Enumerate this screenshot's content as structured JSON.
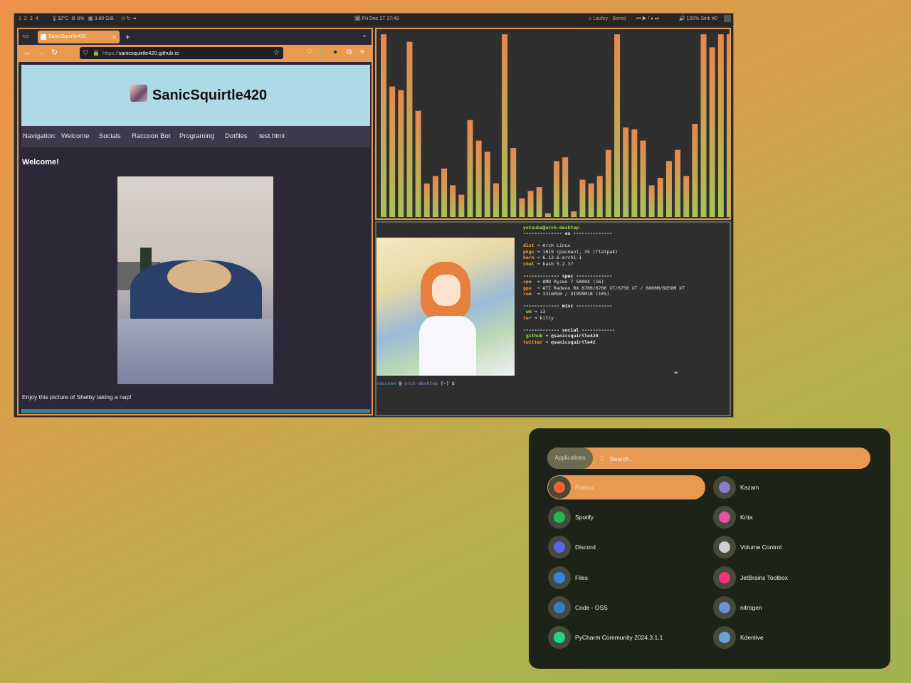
{
  "topbar": {
    "workspaces": [
      "1",
      "2",
      "3",
      "4"
    ],
    "active_workspace": "1",
    "temp": "32°C",
    "cpu": "8%",
    "mem": "3.80 GiB",
    "datetime": "Fri Dec 27 17:49",
    "now_playing": "Laufey - Bored",
    "media_controls": "⏮ ▶ / ⏸ ⏭",
    "volume": "100% Sink #0"
  },
  "browser": {
    "tab_title": "SanicSquirtle420",
    "url_prefix": "https://",
    "url_host": "sanicsquirtle420.github.io",
    "site_title": "SanicSquirtle420",
    "nav_label": "Navigation:",
    "nav_links": [
      "Welcome",
      "Socials",
      "Raccoon Bot",
      "Programing",
      "Dotfiles",
      "test.html"
    ],
    "heading": "Welcome!",
    "caption": "Enjoy this picture of Shelby taking a nap!"
  },
  "visualizer": {
    "bars": [
      0.98,
      0.7,
      0.68,
      0.94,
      0.57,
      0.18,
      0.22,
      0.26,
      0.17,
      0.12,
      0.52,
      0.41,
      0.35,
      0.18,
      0.98,
      0.37,
      0.1,
      0.14,
      0.16,
      0.02,
      0.3,
      0.32,
      0.03,
      0.2,
      0.18,
      0.22,
      0.36,
      0.98,
      0.48,
      0.47,
      0.41,
      0.17,
      0.21,
      0.3,
      0.36,
      0.22,
      0.5,
      0.98,
      0.91,
      0.98,
      0.98
    ],
    "color_top": "#e8874f",
    "color_bottom": "#a8c25a"
  },
  "terminal": {
    "user": "yotsuba",
    "host": "arch-desktop",
    "sections": {
      "os": "os",
      "spec": "spec",
      "misc": "misc",
      "social": "social"
    },
    "rows": [
      {
        "key": "dist",
        "value": "Arch Linux"
      },
      {
        "key": "pkgs",
        "value": "1019 (pacman), 35 (flatpak)"
      },
      {
        "key": "kern",
        "value": "6.12.6-arch1-1"
      },
      {
        "key": "shel",
        "value": "bash 5.2.37"
      },
      {
        "key": "cpu",
        "value": "AMD Ryzen 7 5800X (16)"
      },
      {
        "key": "gpu",
        "value": "ATI Radeon RX 6700/6700 XT/6750 XT / 6800M/6850M XT"
      },
      {
        "key": "ram",
        "value": "3316MiB / 31995MiB (10%)"
      },
      {
        "key": "wm",
        "value": "i3"
      },
      {
        "key": "ter",
        "value": "kitty"
      },
      {
        "key": "github",
        "value": "@sanicsquirtle420"
      },
      {
        "key": "twitter",
        "value": "@sanicsquirtle42"
      }
    ],
    "prompt_user": "raccoon",
    "prompt_at": "@",
    "prompt_host": "arch-desktop",
    "prompt_path": "[~]",
    "prompt_symbol": "$"
  },
  "launcher": {
    "mode": "Applications",
    "separator": "::",
    "search_placeholder": "Search...",
    "apps_left": [
      {
        "name": "Firefox",
        "icon": "firefox-icon",
        "color": "#f2622e",
        "selected": true
      },
      {
        "name": "Spotify",
        "icon": "spotify-icon",
        "color": "#1db954"
      },
      {
        "name": "Discord",
        "icon": "discord-icon",
        "color": "#5865f2"
      },
      {
        "name": "Files",
        "icon": "files-icon",
        "color": "#3d7fe0"
      },
      {
        "name": "Code - OSS",
        "icon": "code-oss-icon",
        "color": "#2f80c9"
      },
      {
        "name": "PyCharm Community 2024.3.1.1",
        "icon": "pycharm-icon",
        "color": "#21d789"
      }
    ],
    "apps_right": [
      {
        "name": "Kazam",
        "icon": "kazam-icon",
        "color": "#8a7cc8"
      },
      {
        "name": "Krita",
        "icon": "krita-icon",
        "color": "#e94fa3"
      },
      {
        "name": "Volume Control",
        "icon": "volume-control-icon",
        "color": "#cfcfcf"
      },
      {
        "name": "JetBrains Toolbox",
        "icon": "jetbrains-toolbox-icon",
        "color": "#f5317f"
      },
      {
        "name": "nitrogen",
        "icon": "nitrogen-icon",
        "color": "#6f8fd8"
      },
      {
        "name": "Kdenlive",
        "icon": "kdenlive-icon",
        "color": "#6aa5d8"
      }
    ]
  }
}
